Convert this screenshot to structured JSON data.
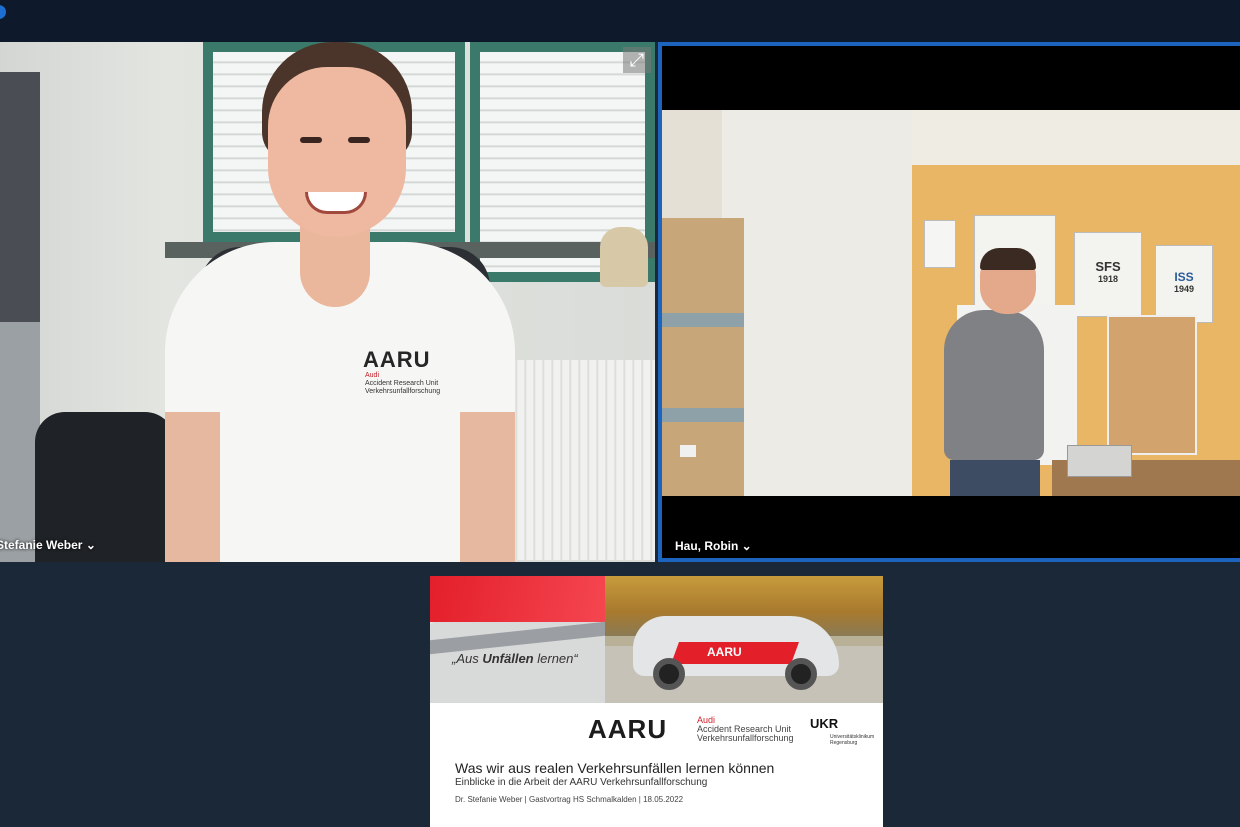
{
  "participants": [
    {
      "name": "Stefanie Weber",
      "chevron": "⌄"
    },
    {
      "name": "Hau, Robin",
      "chevron": "⌄"
    }
  ],
  "icons": {
    "expand": "expand-icon",
    "chevron": "chevron-down-icon"
  },
  "shirt_logo": {
    "brand": "AARU",
    "line1": "Audi",
    "line2": "Accident Research Unit",
    "line3": "Verkehrsunfallforschung"
  },
  "room_posters": [
    {
      "top": "SFS",
      "year": "1918"
    },
    {
      "top": "ISS",
      "year": "1949"
    }
  ],
  "slide": {
    "quote_prefix": "„Aus ",
    "quote_bold": "Unfällen",
    "quote_suffix": " lernen“",
    "car_label": "AARU",
    "brand": "AARU",
    "brand_audi": "Audi",
    "brand_line2": "Accident Research Unit",
    "brand_line3": "Verkehrsunfallforschung",
    "partner": "UKR",
    "partner_sub": "Universitätsklinikum Regensburg",
    "title": "Was wir aus realen Verkehrsunfällen lernen können",
    "subtitle": "Einblicke in die Arbeit der AARU Verkehrsunfallforschung",
    "footer": "Dr. Stefanie Weber | Gastvortrag HS Schmalkalden | 18.05.2022"
  },
  "colors": {
    "background": "#1a2838",
    "topbar": "#0e1a2b",
    "active_speaker_border": "#1d64bf",
    "audi_red": "#e31f2a"
  }
}
